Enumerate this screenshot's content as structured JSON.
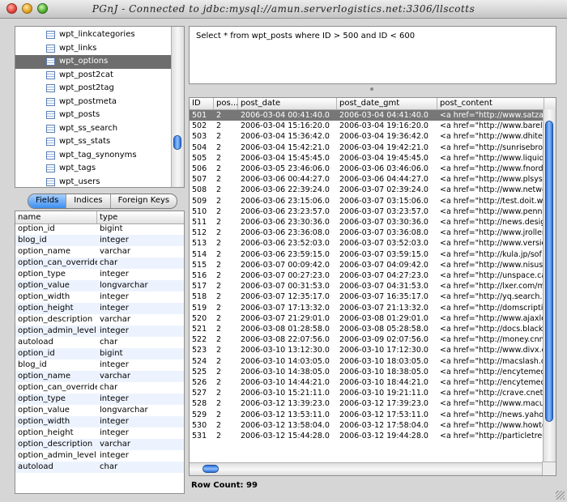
{
  "window": {
    "title": "PGnJ - Connected to jdbc:mysql://amun.serverlogistics.net:3306/llscotts"
  },
  "table_list": {
    "items": [
      "wpt_linkcategories",
      "wpt_links",
      "wpt_options",
      "wpt_post2cat",
      "wpt_post2tag",
      "wpt_postmeta",
      "wpt_posts",
      "wpt_ss_search",
      "wpt_ss_stats",
      "wpt_tag_synonyms",
      "wpt_tags",
      "wpt_users"
    ],
    "selected_index": 2
  },
  "tabs": [
    "Fields",
    "Indices",
    "Foreign Keys"
  ],
  "active_tab": 0,
  "fields": {
    "headers": [
      "name",
      "type"
    ],
    "rows": [
      [
        "option_id",
        "bigint"
      ],
      [
        "blog_id",
        "integer"
      ],
      [
        "option_name",
        "varchar"
      ],
      [
        "option_can_override",
        "char"
      ],
      [
        "option_type",
        "integer"
      ],
      [
        "option_value",
        "longvarchar"
      ],
      [
        "option_width",
        "integer"
      ],
      [
        "option_height",
        "integer"
      ],
      [
        "option_description",
        "varchar"
      ],
      [
        "option_admin_level",
        "integer"
      ],
      [
        "autoload",
        "char"
      ],
      [
        "option_id",
        "bigint"
      ],
      [
        "blog_id",
        "integer"
      ],
      [
        "option_name",
        "varchar"
      ],
      [
        "option_can_override",
        "char"
      ],
      [
        "option_type",
        "integer"
      ],
      [
        "option_value",
        "longvarchar"
      ],
      [
        "option_width",
        "integer"
      ],
      [
        "option_height",
        "integer"
      ],
      [
        "option_description",
        "varchar"
      ],
      [
        "option_admin_level",
        "integer"
      ],
      [
        "autoload",
        "char"
      ]
    ]
  },
  "query": {
    "text": "Select * from wpt_posts where ID > 500 and ID < 600"
  },
  "results": {
    "headers": [
      "ID",
      "pos...",
      "post_date",
      "post_date_gmt",
      "post_content"
    ],
    "selected_index": 0,
    "rows": [
      [
        "501",
        "2",
        "2006-03-04 00:41:40.0",
        "2006-03-04 04:41:40.0",
        "<a href=\"http://www.satzar"
      ],
      [
        "502",
        "2",
        "2006-03-04 15:16:20.0",
        "2006-03-04 19:16:20.0",
        "<a href=\"http://www.barely"
      ],
      [
        "503",
        "2",
        "2006-03-04 15:36:42.0",
        "2006-03-04 19:36:42.0",
        "<a href=\"http://www.dhitec"
      ],
      [
        "504",
        "2",
        "2006-03-04 15:42:21.0",
        "2006-03-04 19:42:21.0",
        "<a href=\"http://sunrisebro"
      ],
      [
        "505",
        "2",
        "2006-03-04 15:45:45.0",
        "2006-03-04 19:45:45.0",
        "<a href=\"http://www.liquid"
      ],
      [
        "506",
        "2",
        "2006-03-05 23:46:06.0",
        "2006-03-06 03:46:06.0",
        "<a href=\"http://www.fnord"
      ],
      [
        "507",
        "2",
        "2006-03-06 00:44:27.0",
        "2006-03-06 04:44:27.0",
        "<a href=\"http://www.plsys."
      ],
      [
        "508",
        "2",
        "2006-03-06 22:39:24.0",
        "2006-03-07 02:39:24.0",
        "<a href=\"http://www.netwo"
      ],
      [
        "509",
        "2",
        "2006-03-06 23:15:06.0",
        "2006-03-07 03:15:06.0",
        "<a href=\"http://test.doit.wi"
      ],
      [
        "510",
        "2",
        "2006-03-06 23:23:57.0",
        "2006-03-07 03:23:57.0",
        "<a href=\"http://www.penny"
      ],
      [
        "511",
        "2",
        "2006-03-06 23:30:36.0",
        "2006-03-07 03:30:36.0",
        "<a href=\"http://news.design"
      ],
      [
        "512",
        "2",
        "2006-03-06 23:36:08.0",
        "2006-03-07 03:36:08.0",
        "<a href=\"http://www.jroller"
      ],
      [
        "513",
        "2",
        "2006-03-06 23:52:03.0",
        "2006-03-07 03:52:03.0",
        "<a href=\"http://www.versio"
      ],
      [
        "514",
        "2",
        "2006-03-06 23:59:15.0",
        "2006-03-07 03:59:15.0",
        "<a href=\"http://kula.jp/sof"
      ],
      [
        "515",
        "2",
        "2006-03-07 00:09:42.0",
        "2006-03-07 04:09:42.0",
        "<a href=\"http://www.nisus."
      ],
      [
        "516",
        "2",
        "2006-03-07 00:27:23.0",
        "2006-03-07 04:27:23.0",
        "<a href=\"http://unspace.ca"
      ],
      [
        "517",
        "2",
        "2006-03-07 00:31:53.0",
        "2006-03-07 04:31:53.0",
        "<a href=\"http://lxer.com/m"
      ],
      [
        "518",
        "2",
        "2006-03-07 12:35:17.0",
        "2006-03-07 16:35:17.0",
        "<a href=\"http://yq.search.y"
      ],
      [
        "519",
        "2",
        "2006-03-07 17:13:32.0",
        "2006-03-07 21:13:32.0",
        "<a href=\"http://domscripti"
      ],
      [
        "520",
        "2",
        "2006-03-07 21:29:01.0",
        "2006-03-08 01:29:01.0",
        "<a href=\"http://www.ajaxle"
      ],
      [
        "521",
        "2",
        "2006-03-08 01:28:58.0",
        "2006-03-08 05:28:58.0",
        "<a href=\"http://docs.blackt"
      ],
      [
        "522",
        "2",
        "2006-03-08 22:07:56.0",
        "2006-03-09 02:07:56.0",
        "<a href=\"http://money.cnn"
      ],
      [
        "523",
        "2",
        "2006-03-10 13:12:30.0",
        "2006-03-10 17:12:30.0",
        "<a href=\"http://www.divx.c"
      ],
      [
        "524",
        "2",
        "2006-03-10 14:03:05.0",
        "2006-03-10 18:03:05.0",
        "<a href=\"http://macslash.o"
      ],
      [
        "525",
        "2",
        "2006-03-10 14:38:05.0",
        "2006-03-10 18:38:05.0",
        "<a href=\"http://encytemed"
      ],
      [
        "526",
        "2",
        "2006-03-10 14:44:21.0",
        "2006-03-10 18:44:21.0",
        "<a href=\"http://encytemed"
      ],
      [
        "527",
        "2",
        "2006-03-10 15:21:11.0",
        "2006-03-10 19:21:11.0",
        "<a href=\"http://crave.cnet."
      ],
      [
        "528",
        "2",
        "2006-03-12 13:39:23.0",
        "2006-03-12 17:39:23.0",
        "<a href=\"http://www.macup"
      ],
      [
        "529",
        "2",
        "2006-03-12 13:53:11.0",
        "2006-03-12 17:53:11.0",
        "<a href=\"http://news.yahoo"
      ],
      [
        "530",
        "2",
        "2006-03-12 13:58:04.0",
        "2006-03-12 17:58:04.0",
        "<a href=\"http://www.howto"
      ],
      [
        "531",
        "2",
        "2006-03-12 15:44:28.0",
        "2006-03-12 19:44:28.0",
        "<a href=\"http://particletree"
      ]
    ]
  },
  "status": {
    "row_count": "Row Count: 99"
  }
}
